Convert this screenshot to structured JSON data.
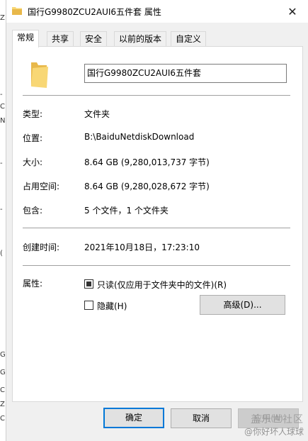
{
  "window": {
    "title": "国行G9980ZCU2AUI6五件套 属性",
    "close_glyph": "✕"
  },
  "tabs": [
    {
      "label": "常规",
      "active": true
    },
    {
      "label": "共享",
      "active": false
    },
    {
      "label": "安全",
      "active": false
    },
    {
      "label": "以前的版本",
      "active": false
    },
    {
      "label": "自定义",
      "active": false
    }
  ],
  "general": {
    "name": "国行G9980ZCU2AUI6五件套",
    "props": [
      {
        "label": "类型:",
        "value": "文件夹"
      },
      {
        "label": "位置:",
        "value": "B:\\BaiduNetdiskDownload"
      },
      {
        "label": "大小:",
        "value": "8.64 GB (9,280,013,737 字节)"
      },
      {
        "label": "占用空间:",
        "value": "8.64 GB (9,280,028,672 字节)"
      },
      {
        "label": "包含:",
        "value": "5 个文件，1 个文件夹"
      }
    ],
    "created": {
      "label": "创建时间:",
      "value": "2021年10月18日，17:23:10"
    },
    "attributes": {
      "label": "属性:",
      "readonly_label": "只读(仅应用于文件夹中的文件)(R)",
      "readonly_state": "indeterminate",
      "hidden_label": "隐藏(H)",
      "hidden_checked": false,
      "advanced_label": "高级(D)..."
    }
  },
  "footer": {
    "ok_label": "确定",
    "cancel_label": "取消",
    "apply_label": "应用(A)"
  },
  "watermark": {
    "line1": "盖乐世社区",
    "line2": "@你好坏人球球"
  },
  "background_chars": [
    "Z",
    "-",
    "C",
    "N",
    "-",
    "-",
    "(",
    "G",
    "G",
    "C",
    "Z",
    "C"
  ],
  "colors": {
    "folder_yellow": "#f8d775",
    "folder_dark": "#e8b84a",
    "accent_blue": "#0078d7",
    "dialog_bg": "#f0f0f0"
  }
}
